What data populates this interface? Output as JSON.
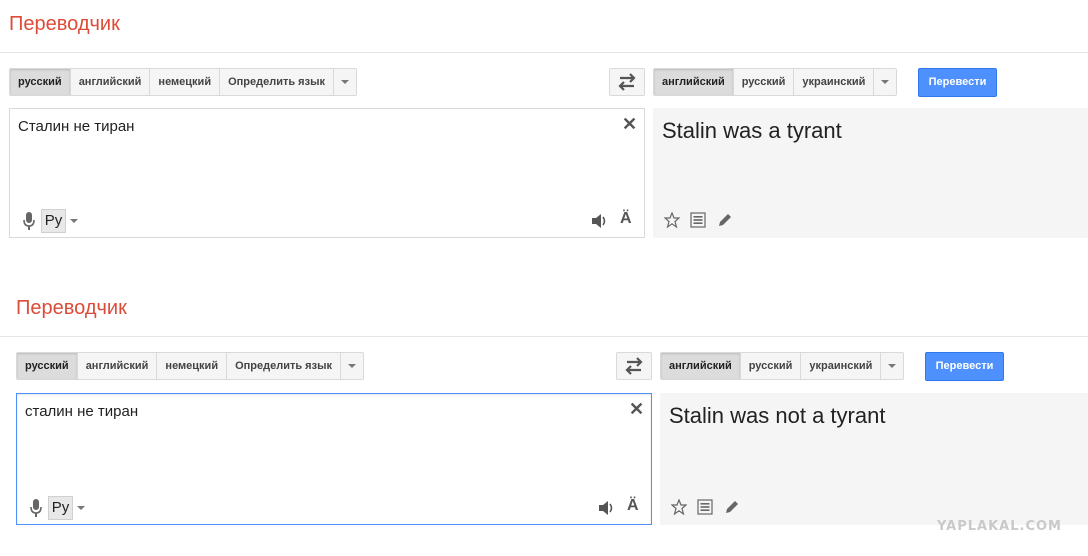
{
  "panels": [
    {
      "title": "Переводчик",
      "source_langs": [
        "русский",
        "английский",
        "немецкий",
        "Определить язык"
      ],
      "target_langs": [
        "английский",
        "русский",
        "украинский"
      ],
      "translate_label": "Перевести",
      "input_text": "Сталин не тиран",
      "ime_label": "Ру",
      "umlaut_label": "Ä",
      "output_text": "Stalin was a tyrant"
    },
    {
      "title": "Переводчик",
      "source_langs": [
        "русский",
        "английский",
        "немецкий",
        "Определить язык"
      ],
      "target_langs": [
        "английский",
        "русский",
        "украинский"
      ],
      "translate_label": "Перевести",
      "input_text": "сталин не тиран",
      "ime_label": "Ру",
      "umlaut_label": "Ä",
      "output_text": "Stalin was not a tyrant"
    }
  ],
  "watermark": "YAPLAKAL.COM",
  "icons": {
    "swap": "swap-arrows-icon",
    "clear": "close-icon",
    "mic": "microphone-icon",
    "speaker": "speaker-icon",
    "star": "star-icon",
    "list": "list-icon",
    "edit": "pencil-icon"
  }
}
